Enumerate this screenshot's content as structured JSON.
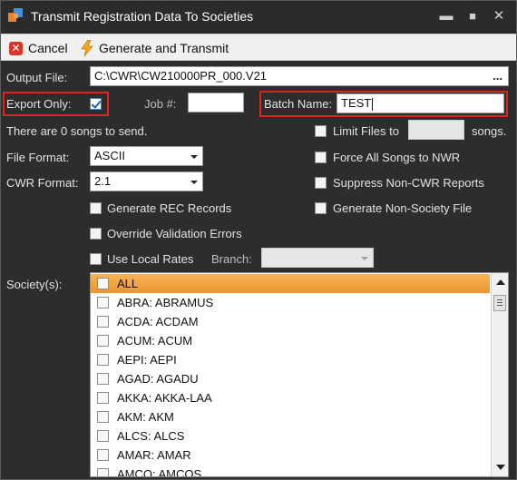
{
  "window": {
    "title": "Transmit Registration Data To Societies",
    "controls": {
      "minimize": "▬",
      "maximize": "■",
      "close": "✕"
    }
  },
  "toolbar": {
    "cancel_label": "Cancel",
    "generate_label": "Generate and Transmit"
  },
  "form": {
    "output_file_label": "Output File:",
    "output_file_value": "C:\\CWR\\CW210000PR_000.V21",
    "browse_label": "...",
    "export_only_label": "Export Only:",
    "export_only_checked": true,
    "job_label": "Job #:",
    "job_value": "",
    "batch_name_label": "Batch Name:",
    "batch_name_value": "TEST",
    "songs_status": "There are 0 songs to send.",
    "limit_files_label": "Limit Files to",
    "limit_files_value": "",
    "limit_files_suffix": "songs.",
    "file_format_label": "File Format:",
    "file_format_value": "ASCII",
    "cwr_format_label": "CWR Format:",
    "cwr_format_value": "2.1",
    "force_nwr_label": "Force All Songs to NWR",
    "suppress_label": "Suppress Non-CWR Reports",
    "generate_rec_label": "Generate REC Records",
    "generate_non_society_label": "Generate Non-Society File",
    "override_label": "Override Validation Errors",
    "local_rates_label": "Use Local Rates",
    "branch_label": "Branch:",
    "branch_value": "",
    "societies_label": "Society(s):"
  },
  "societies": [
    "ALL",
    "ABRA: ABRAMUS",
    "ACDA: ACDAM",
    "ACUM: ACUM",
    "AEPI: AEPI",
    "AGAD: AGADU",
    "AKKA: AKKA-LAA",
    "AKM: AKM",
    "ALCS: ALCS",
    "AMAR: AMAR",
    "AMCO: AMCOS"
  ],
  "colors": {
    "highlight_border": "#e0231b",
    "selected_row": "#f0a03c",
    "window_bg": "#2d2d2d"
  },
  "icons": [
    "app-icon",
    "cancel-icon",
    "lightning-bolt-icon",
    "checkbox-icon",
    "dropdown-arrow-icon",
    "scroll-up-icon",
    "scroll-down-icon"
  ]
}
